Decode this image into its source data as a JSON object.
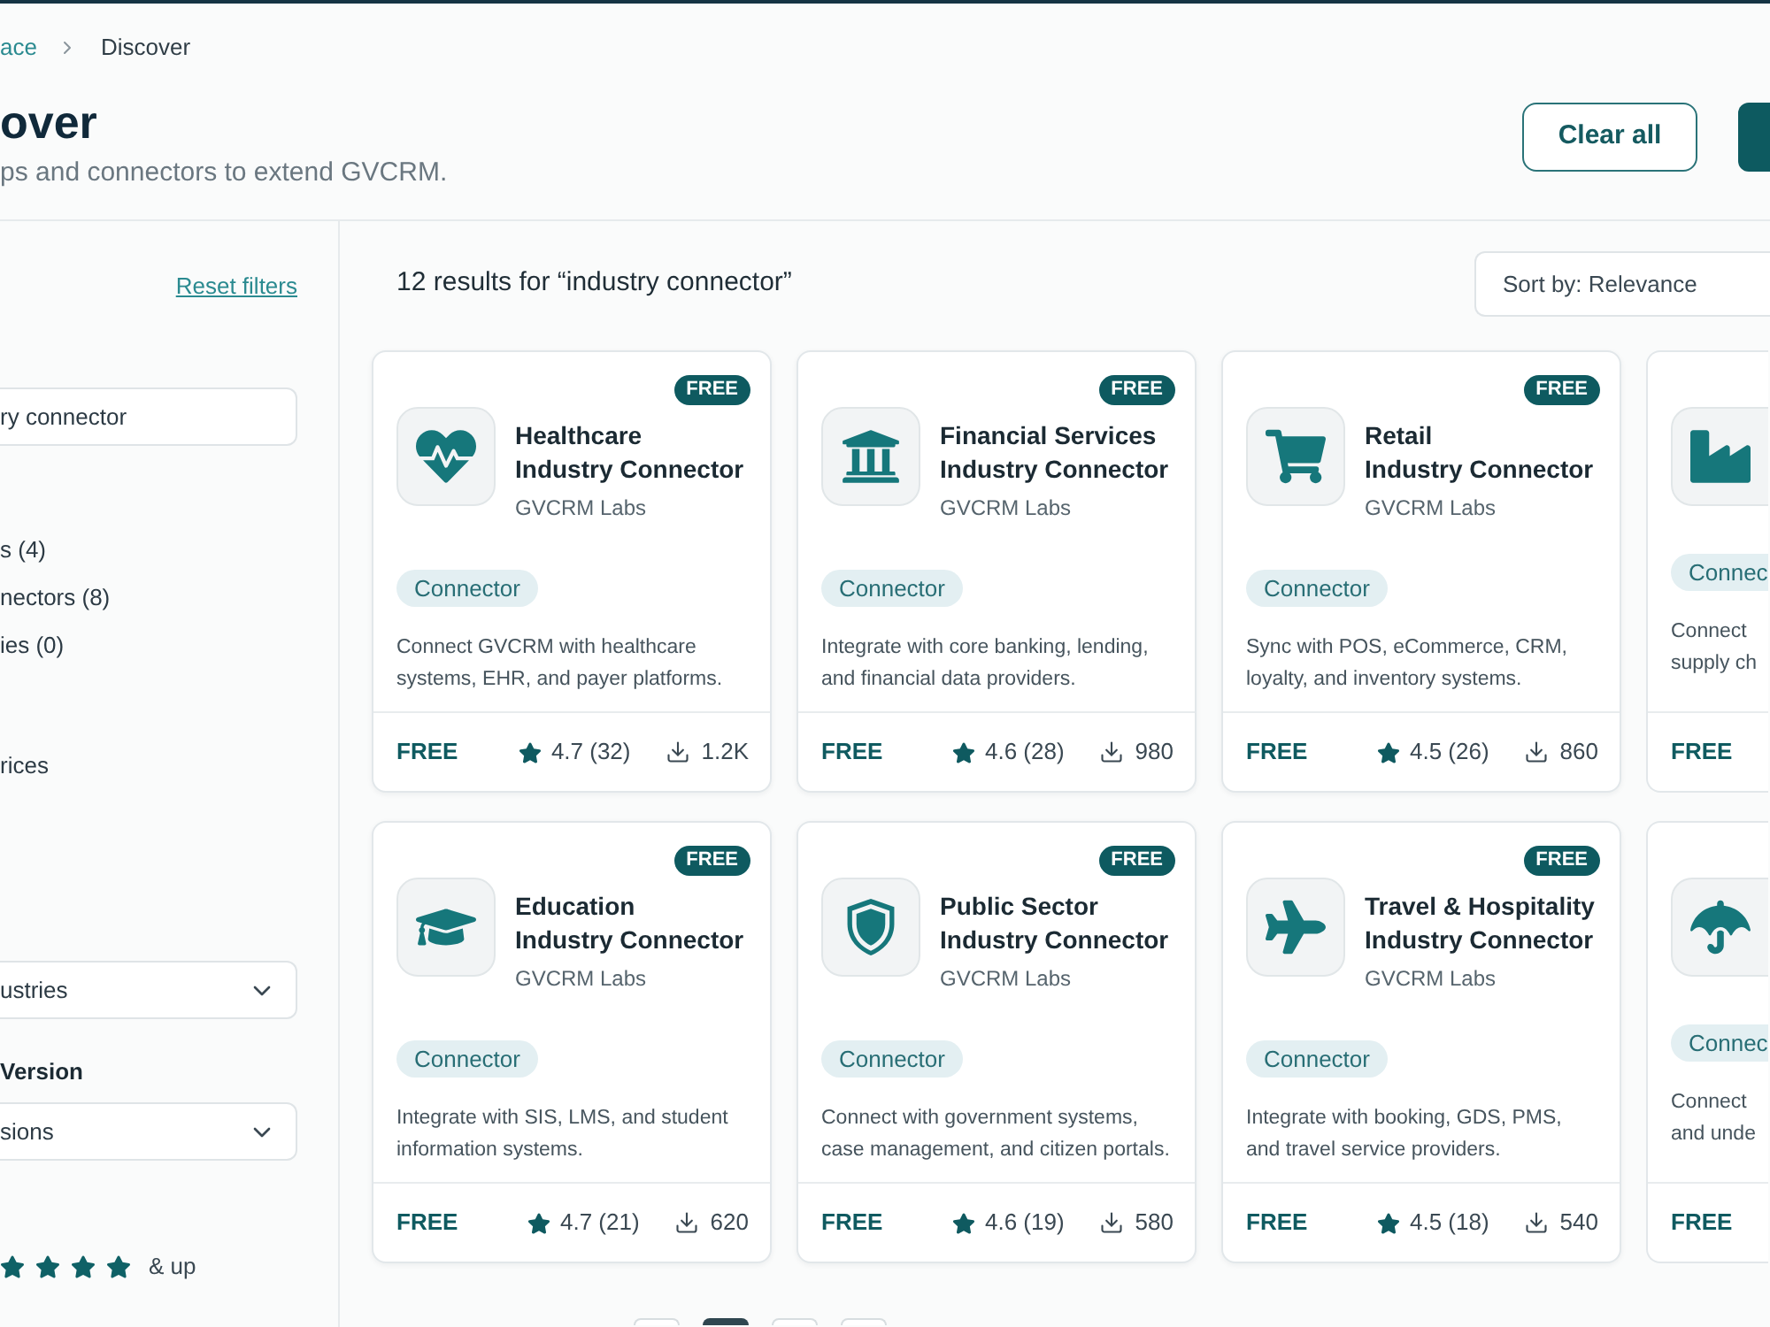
{
  "breadcrumb": [
    {
      "label": "ace",
      "current": false
    },
    {
      "label": "Discover",
      "current": true
    }
  ],
  "page_title": "over",
  "subtitle": "ps and connectors to extend GVCRM.",
  "clear_all_button": "Clear all",
  "sidebar": {
    "reset_link": "Reset filters",
    "search": {
      "value": "ry connector"
    },
    "type_options": [
      "s (4)",
      "nectors (8)",
      "ies (0)"
    ],
    "pricing_option": "rices",
    "industry_select": {
      "value": "ustries"
    },
    "version_filter": {
      "label": "Version",
      "select": {
        "value": "sions"
      }
    },
    "rating_filter": {
      "stars": 4,
      "label": "& up"
    }
  },
  "results": {
    "heading": "12 results for “industry connector”",
    "sort": {
      "value": "Sort by: Relevance"
    }
  },
  "cards": [
    {
      "kind": "full",
      "badge": "FREE",
      "title": "Healthcare\nIndustry Connector",
      "publisher": "GVCRM Labs",
      "tag": "Connector",
      "description": "Connect GVCRM with healthcare\nsystems, EHR, and payer platforms.",
      "price": "FREE",
      "rating": "4.7 (32)",
      "downloads": "1.2K"
    },
    {
      "kind": "full",
      "badge": "FREE",
      "title": "Financial Services\nIndustry Connector",
      "publisher": "GVCRM Labs",
      "tag": "Connector",
      "description": "Integrate with core banking, lending,\nand financial data providers.",
      "price": "FREE",
      "rating": "4.6 (28)",
      "downloads": "980"
    },
    {
      "kind": "full",
      "badge": "FREE",
      "title": "Retail\nIndustry Connector",
      "publisher": "GVCRM Labs",
      "tag": "Connector",
      "description": "Sync with POS, eCommerce, CRM,\nloyalty, and inventory systems.",
      "price": "FREE",
      "rating": "4.5 (26)",
      "downloads": "860"
    },
    {
      "kind": "clipped",
      "tag": "Connec",
      "description": "Connect\nsupply ch",
      "price": "FREE"
    },
    {
      "kind": "full",
      "badge": "FREE",
      "title": "Education\nIndustry Connector",
      "publisher": "GVCRM Labs",
      "tag": "Connector",
      "description": "Integrate with SIS, LMS, and student\ninformation systems.",
      "price": "FREE",
      "rating": "4.7 (21)",
      "downloads": "620"
    },
    {
      "kind": "full",
      "badge": "FREE",
      "title": "Public Sector\nIndustry Connector",
      "publisher": "GVCRM Labs",
      "tag": "Connector",
      "description": "Connect with government systems,\ncase management, and citizen portals.",
      "price": "FREE",
      "rating": "4.6 (19)",
      "downloads": "580"
    },
    {
      "kind": "full",
      "badge": "FREE",
      "title": "Travel & Hospitality\nIndustry Connector",
      "publisher": "GVCRM Labs",
      "tag": "Connector",
      "description": "Integrate with booking, GDS, PMS,\nand travel service providers.",
      "price": "FREE",
      "rating": "4.5 (18)",
      "downloads": "540"
    },
    {
      "kind": "clipped",
      "tag": "Connec",
      "description": "Connect\nand unde",
      "price": "FREE"
    }
  ],
  "pagination": [
    {
      "selected": false
    },
    {
      "selected": true
    },
    {
      "selected": false
    },
    {
      "selected": false
    }
  ]
}
